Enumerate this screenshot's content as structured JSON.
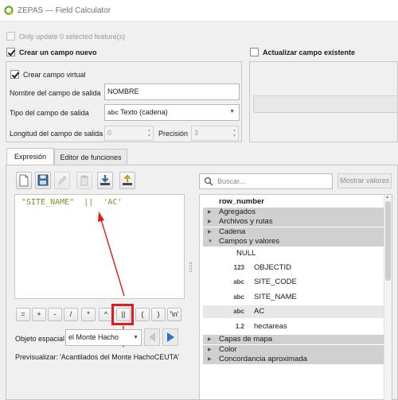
{
  "window": {
    "title": "ZEPAS — Field Calculator",
    "qgis_accent": "#6aa63a"
  },
  "update_selected": {
    "label": "Only update 0 selected feature(s)",
    "checked": false,
    "enabled": false
  },
  "crear": {
    "label": "Crear un campo nuevo",
    "checked": true,
    "virtual_label": "Crear campo virtual",
    "virtual_checked": true,
    "nombre_label": "Nombre del campo de salida",
    "nombre_value": "NOMBRE",
    "tipo_label": "Tipo del campo de salida",
    "tipo_icon": "abc",
    "tipo_value": "Texto (cadena)",
    "longitud_label": "Longitud del campo de salida",
    "longitud_value": "0",
    "precision_label": "Precisión",
    "precision_value": "3"
  },
  "actualizar": {
    "label": "Actualizar campo existente",
    "checked": false
  },
  "tabs": [
    {
      "label": "Expresión",
      "active": true
    },
    {
      "label": "Editor de funciones",
      "active": false
    }
  ],
  "toolbar": {
    "icons": [
      "new-file-icon",
      "save-icon",
      "edit-icon",
      "delete-icon",
      "import-icon",
      "export-icon"
    ]
  },
  "expression": {
    "part1": "\"SITE_NAME\"",
    "operator": "||",
    "part2": "'AC'",
    "color": "#8a8a2e"
  },
  "operators": [
    "=",
    "+",
    "-",
    "/",
    "*",
    "^",
    "||",
    "(",
    ")",
    "'\\n'"
  ],
  "highlight_color": "#e01b1b",
  "feature": {
    "label": "Objeto espacial",
    "value": "el Monte Hacho"
  },
  "preview": {
    "label": "Previsualizar:",
    "value": "'Acantilados del Monte HachoCEUTA'"
  },
  "search": {
    "placeholder": "Buscar...",
    "show_values_label": "Mostrar valores"
  },
  "function_tree": [
    {
      "label": "row_number",
      "kind": "header"
    },
    {
      "label": "Agregados",
      "kind": "group",
      "open": false
    },
    {
      "label": "Archivos y rutas",
      "kind": "group",
      "open": false
    },
    {
      "label": "Cadena",
      "kind": "group",
      "open": false
    },
    {
      "label": "Campos y valores",
      "kind": "group",
      "open": true
    },
    {
      "label": "NULL",
      "kind": "field",
      "type": ""
    },
    {
      "label": "OBJECTID",
      "kind": "field",
      "type": "123"
    },
    {
      "label": "SITE_CODE",
      "kind": "field",
      "type": "abc"
    },
    {
      "label": "SITE_NAME",
      "kind": "field",
      "type": "abc"
    },
    {
      "label": "AC",
      "kind": "field",
      "type": "abc"
    },
    {
      "label": "hectareas",
      "kind": "field",
      "type": "1.2"
    },
    {
      "label": "Capas de mapa",
      "kind": "group",
      "open": false
    },
    {
      "label": "Color",
      "kind": "group",
      "open": false
    },
    {
      "label": "Concordancia aproximada",
      "kind": "group",
      "open": false
    }
  ]
}
